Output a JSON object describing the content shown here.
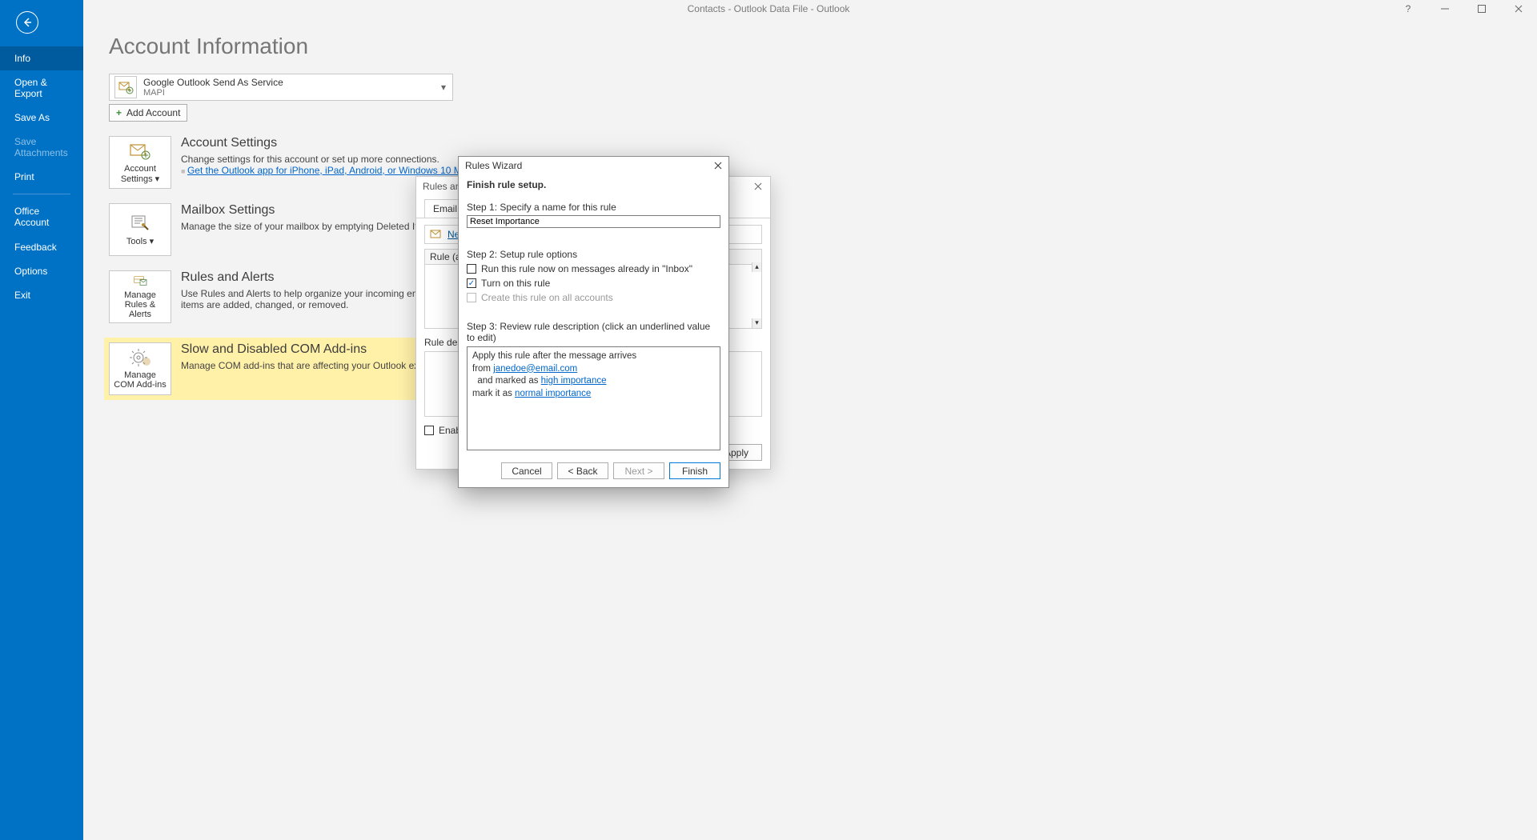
{
  "window": {
    "title": "Contacts - Outlook Data File  -  Outlook"
  },
  "sidebar": {
    "items": [
      {
        "label": "Info",
        "selected": true
      },
      {
        "label": "Open & Export"
      },
      {
        "label": "Save As"
      },
      {
        "label": "Save Attachments",
        "disabled": true
      },
      {
        "label": "Print"
      },
      {
        "label": "Office Account",
        "sep_before": true
      },
      {
        "label": "Feedback"
      },
      {
        "label": "Options"
      },
      {
        "label": "Exit"
      }
    ]
  },
  "page": {
    "title": "Account Information",
    "account": {
      "name": "Google Outlook Send As Service",
      "proto": "MAPI"
    },
    "add_account": "Add Account",
    "sections": [
      {
        "btn": "Account Settings ▾",
        "title": "Account Settings",
        "desc": "Change settings for this account or set up more connections.",
        "link": "Get the Outlook app for iPhone, iPad, Android, or Windows 10 Mobile."
      },
      {
        "btn": "Tools ▾",
        "title": "Mailbox Settings",
        "desc": "Manage the size of your mailbox by emptying Deleted Items and archiving."
      },
      {
        "btn": "Manage Rules & Alerts",
        "title": "Rules and Alerts",
        "desc": "Use Rules and Alerts to help organize your incoming email messages, and receive updates when items are added, changed, or removed."
      },
      {
        "btn": "Manage COM Add-ins",
        "title": "Slow and Disabled COM Add-ins",
        "desc": "Manage COM add-ins that are affecting your Outlook experience.",
        "highlight": true
      }
    ]
  },
  "rules_alerts": {
    "title": "Rules and Alerts",
    "tab1": "Email Rules",
    "new_rule": "New Rule…",
    "grid_header": "Rule (applied in the order shown)",
    "desc_label": "Rule description (click an underlined value to edit):",
    "enable": "Enable rules on all messages downloaded from RSS Feeds",
    "apply": "Apply"
  },
  "wizard": {
    "title": "Rules Wizard",
    "subtitle": "Finish rule setup.",
    "step1": "Step 1: Specify a name for this rule",
    "rule_name": "Reset Importance",
    "step2": "Step 2: Setup rule options",
    "opt1": "Run this rule now on messages already in \"Inbox\"",
    "opt2": "Turn on this rule",
    "opt3": "Create this rule on all accounts",
    "step3": "Step 3: Review rule description (click an underlined value to edit)",
    "review": {
      "line1": "Apply this rule after the message arrives",
      "line2_pre": "from ",
      "line2_link": "janedoe@email.com",
      "line3_pre": "  and marked as ",
      "line3_link": "high importance",
      "line4_pre": "mark it as ",
      "line4_link": "normal importance"
    },
    "btn_cancel": "Cancel",
    "btn_back": "<  Back",
    "btn_next": "Next  >",
    "btn_finish": "Finish"
  }
}
